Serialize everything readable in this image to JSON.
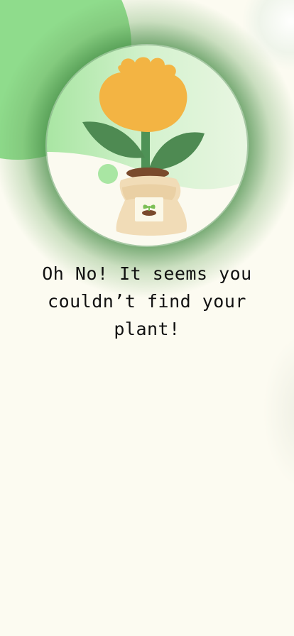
{
  "screen": {
    "message": "Oh No! It seems you couldn’t find your plant!",
    "illustration": "potted-flower-in-sack",
    "colors": {
      "background": "#fcfbf1",
      "accent_green": "#8fdc8c",
      "dark_green": "#4b8b52",
      "flower_orange": "#f3b443",
      "sack_beige": "#f1dcb7",
      "soil_brown": "#7a4a2c"
    }
  }
}
